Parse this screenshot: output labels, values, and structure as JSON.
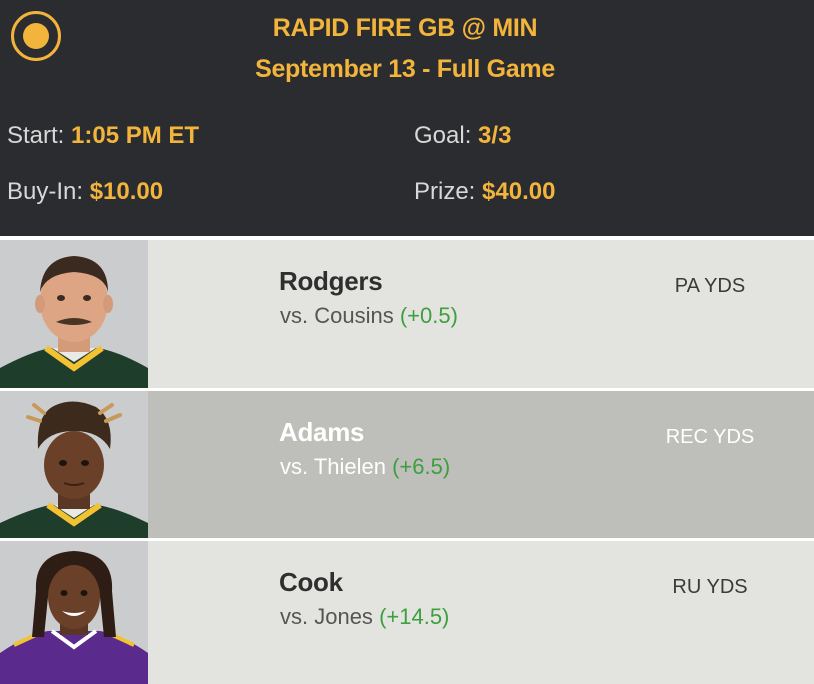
{
  "contest": {
    "title": "RAPID FIRE GB @ MIN",
    "subtitle": "September 13 - Full Game",
    "start_label": "Start:",
    "start_value": "1:05 PM ET",
    "goal_label": "Goal:",
    "goal_value": "3/3",
    "buyin_label": "Buy-In:",
    "buyin_value": "$10.00",
    "prize_label": "Prize:",
    "prize_value": "$40.00"
  },
  "colors": {
    "accent": "#f3b43c",
    "header_bg": "#2b2c2f",
    "spread_green": "#3d9f3d"
  },
  "players": [
    {
      "name": "Rodgers",
      "vs_text": "vs. Cousins",
      "spread": "(+0.5)",
      "stat": "PA YDS"
    },
    {
      "name": "Adams",
      "vs_text": "vs. Thielen",
      "spread": "(+6.5)",
      "stat": "REC YDS"
    },
    {
      "name": "Cook",
      "vs_text": "vs. Jones",
      "spread": "(+14.5)",
      "stat": "RU YDS"
    }
  ]
}
